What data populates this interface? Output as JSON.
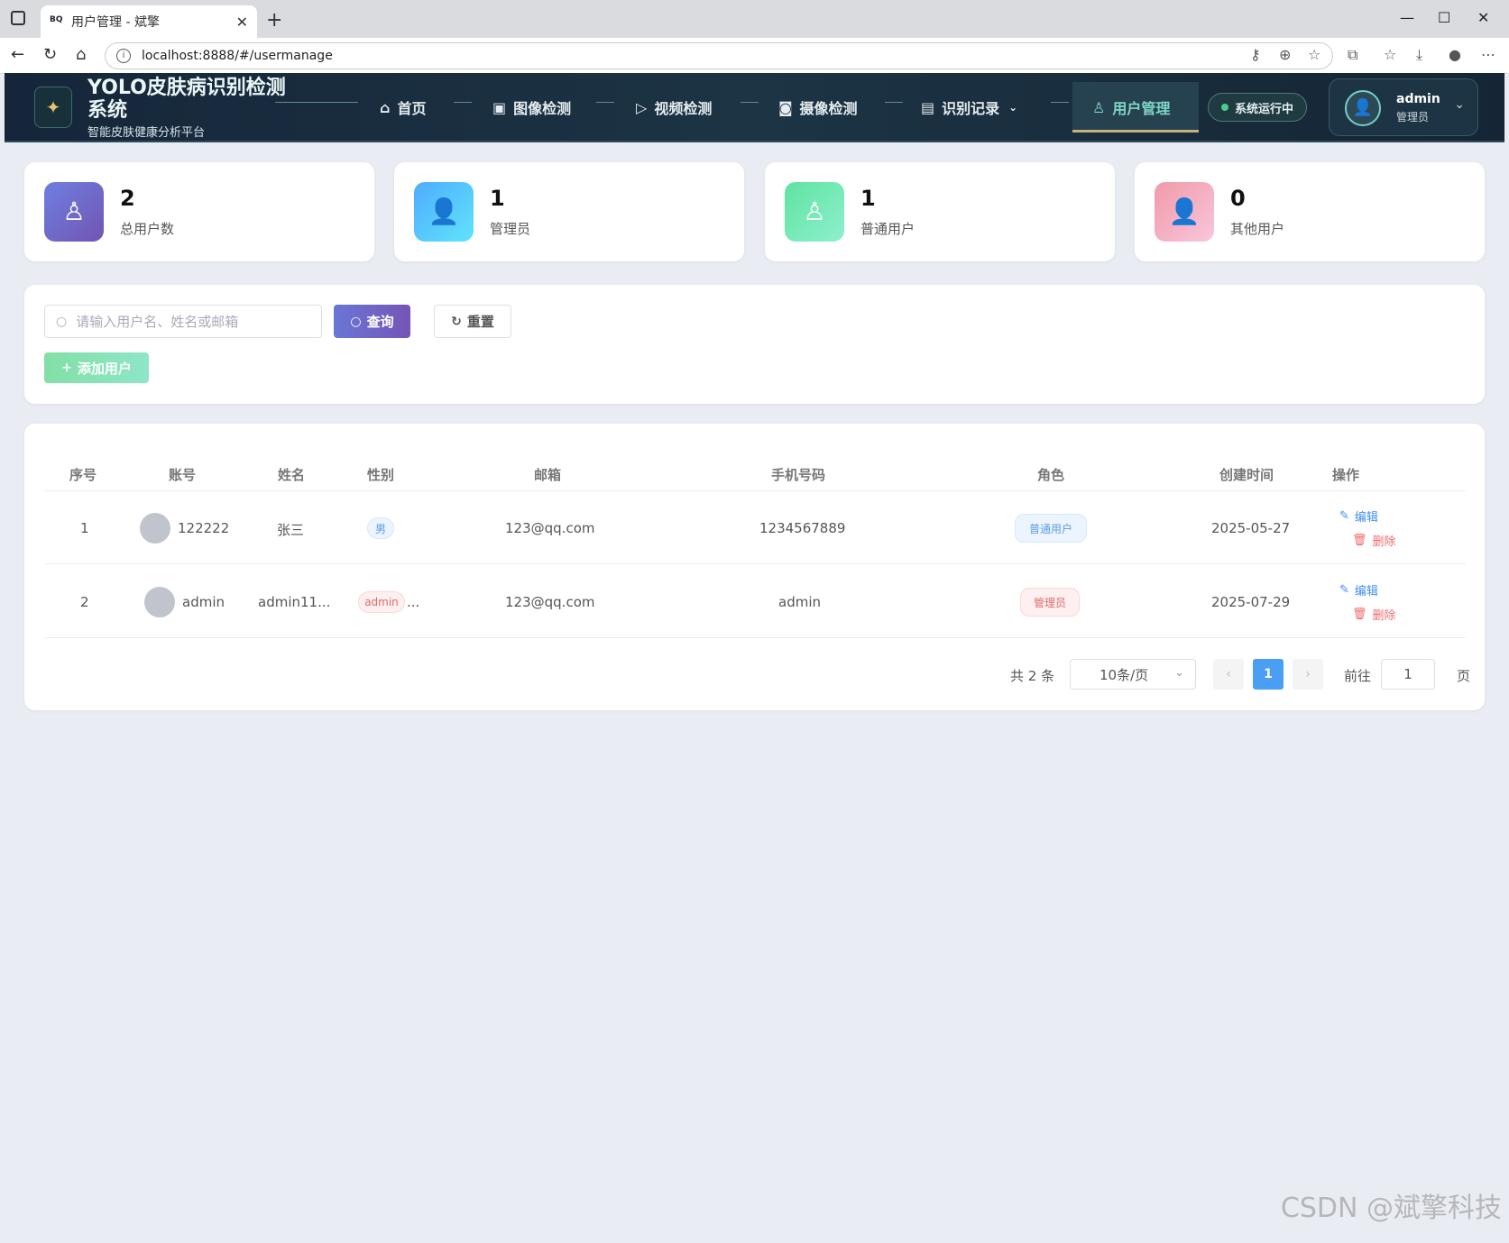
{
  "browser": {
    "tab_title": "用户管理 - 斌擎",
    "tab_favicon": "BQ",
    "url": "localhost:8888/#/usermanage"
  },
  "header": {
    "title": "YOLO皮肤病识别检测系统",
    "subtitle": "智能皮肤健康分析平台",
    "nav": [
      {
        "label": "首页",
        "icon": "home-icon"
      },
      {
        "label": "图像检测",
        "icon": "image-icon"
      },
      {
        "label": "视频检测",
        "icon": "play-circle-icon"
      },
      {
        "label": "摄像检测",
        "icon": "camera-icon"
      },
      {
        "label": "识别记录",
        "icon": "document-icon"
      },
      {
        "label": "用户管理",
        "icon": "user-icon",
        "active": true
      }
    ],
    "status": "系统运行中",
    "user": {
      "name": "admin",
      "role": "管理员"
    }
  },
  "stats": [
    {
      "value": "2",
      "label": "总用户数",
      "color": "#6d61c9"
    },
    {
      "value": "1",
      "label": "管理员",
      "color": "#4facfe"
    },
    {
      "value": "1",
      "label": "普通用户",
      "color": "#5fe0a3"
    },
    {
      "value": "0",
      "label": "其他用户",
      "color": "#f29aac"
    }
  ],
  "search": {
    "placeholder": "请输入用户名、姓名或邮箱",
    "query_label": "查询",
    "reset_label": "重置",
    "add_label": "添加用户"
  },
  "table": {
    "columns": [
      "序号",
      "账号",
      "姓名",
      "性别",
      "邮箱",
      "手机号码",
      "角色",
      "创建时间",
      "操作"
    ],
    "rows": [
      {
        "index": "1",
        "account": "122222",
        "name": "张三",
        "gender": "男",
        "gender_extra": "",
        "email": "123@qq.com",
        "phone": "1234567889",
        "role": "普通用户",
        "created": "2025-05-27"
      },
      {
        "index": "2",
        "account": "admin",
        "name": "admin11...",
        "gender": "admin",
        "gender_extra": "...",
        "email": "123@qq.com",
        "phone": "admin",
        "role": "管理员",
        "created": "2025-07-29"
      }
    ],
    "edit_label": "编辑",
    "delete_label": "删除"
  },
  "pagination": {
    "total": "共 2 条",
    "page_size": "10条/页",
    "current": "1",
    "goto_label": "前往",
    "goto_value": "1",
    "page_suffix": "页"
  },
  "watermark": "CSDN @斌擎科技"
}
